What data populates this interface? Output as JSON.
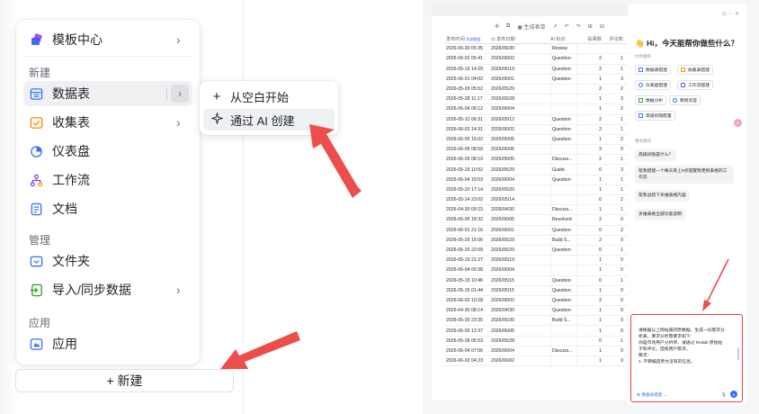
{
  "menu": {
    "header": {
      "label": "模板中心"
    },
    "section_new": "新建",
    "items_new": [
      {
        "label": "数据表",
        "icon": "table-icon",
        "color": "#3370ff"
      },
      {
        "label": "收集表",
        "icon": "form-icon",
        "color": "#ff8800"
      },
      {
        "label": "仪表盘",
        "icon": "dashboard-icon",
        "color": "#3370ff"
      },
      {
        "label": "工作流",
        "icon": "workflow-icon",
        "color": "#7f3bf5"
      },
      {
        "label": "文档",
        "icon": "doc-icon",
        "color": "#3370ff"
      }
    ],
    "section_manage": "管理",
    "items_manage": [
      {
        "label": "文件夹",
        "icon": "folder-icon",
        "color": "#3370ff"
      },
      {
        "label": "导入/同步数据",
        "icon": "import-icon",
        "color": "#2ea121"
      }
    ],
    "section_app": "应用",
    "items_app": [
      {
        "label": "应用",
        "icon": "app-icon",
        "color": "#3370ff"
      }
    ]
  },
  "new_button": {
    "label": "+ 新建"
  },
  "submenu": {
    "items": [
      {
        "label": "从空白开始",
        "icon": "plus-icon"
      },
      {
        "label": "通过 AI 创建",
        "icon": "sparkle-icon"
      }
    ]
  },
  "table": {
    "toolbar": {
      "generate_report": "生成表单"
    },
    "headers": [
      "发布时间",
      "发布日期",
      "AI 标识",
      "投票数",
      "评论数"
    ],
    "header_badge": "外部数据",
    "rows": [
      [
        "2026-06-30 05:35",
        "2026/06/30",
        "Review",
        "",
        ""
      ],
      [
        "2026-06-02 05:41",
        "2026/06/02",
        "Question",
        "2",
        "1"
      ],
      [
        "2026-05-19 14:29",
        "2026/05/19",
        "Question",
        "2",
        "1"
      ],
      [
        "2026-06-01 04:02",
        "2026/06/01",
        "Question",
        "1",
        "3"
      ],
      [
        "2026-05-29 05:52",
        "2026/05/29",
        "",
        "2",
        "2"
      ],
      [
        "2026-05-28 11:17",
        "2026/05/28",
        "",
        "1",
        "3"
      ],
      [
        "2026-06-04 06:12",
        "2026/06/04",
        "",
        "1",
        "2"
      ],
      [
        "2026-05-12 06:31",
        "2026/05/12",
        "Question",
        "2",
        "1"
      ],
      [
        "2026-06-02 14:31",
        "2026/06/02",
        "Question",
        "2",
        "1"
      ],
      [
        "2026-06-05 15:02",
        "2026/06/05",
        "Question",
        "1",
        "2"
      ],
      [
        "2026-06-06 08:59",
        "2026/06/06",
        "",
        "3",
        "0"
      ],
      [
        "2026-06-05 08:19",
        "2026/06/05",
        "Discuss...",
        "2",
        "1"
      ],
      [
        "2026-05-29 10:52",
        "2026/05/29",
        "Guide",
        "0",
        "3"
      ],
      [
        "2026-06-04 19:53",
        "2026/06/04",
        "Question",
        "1",
        "1"
      ],
      [
        "2026-05-20 17:14",
        "2026/05/20",
        "",
        "1",
        "1"
      ],
      [
        "2026-05-14 23:02",
        "2026/05/14",
        "",
        "0",
        "2"
      ],
      [
        "2026-04-30 09:23",
        "2026/04/30",
        "Discuss...",
        "1",
        "1"
      ],
      [
        "2026-06-05 18:32",
        "2026/06/05",
        "Resolved",
        "2",
        "0"
      ],
      [
        "2026-06-01 21:16",
        "2026/06/01",
        "Question",
        "0",
        "2"
      ],
      [
        "2026-05-29 15:06",
        "2026/05/29",
        "Build S...",
        "2",
        "0"
      ],
      [
        "2026-05-20 22:09",
        "2026/05/20",
        "Question",
        "0",
        "1"
      ],
      [
        "2026-05-19 21:27",
        "2026/05/19",
        "",
        "1",
        "0"
      ],
      [
        "2026-06-04 00:38",
        "2026/06/04",
        "",
        "1",
        "0"
      ],
      [
        "2026-05-15 10:46",
        "2026/05/15",
        "Question",
        "0",
        "1"
      ],
      [
        "2026-05-15 01:44",
        "2026/05/15",
        "Question",
        "1",
        "0"
      ],
      [
        "2026-06-02 10:28",
        "2026/06/02",
        "Question",
        "2",
        "0"
      ],
      [
        "2026-04-30 08:14",
        "2026/04/30",
        "Question",
        "1",
        "0"
      ],
      [
        "2026-05-30 23:35",
        "2026/05/30",
        "Build S...",
        "1",
        "0"
      ],
      [
        "2026-06-05 12:37",
        "2026/06/05",
        "",
        "1",
        "0"
      ],
      [
        "2026-05-28 05:53",
        "2026/05/28",
        "",
        "0",
        "1"
      ],
      [
        "2026-06-04 07:56",
        "2026/06/04",
        "Discuss...",
        "1",
        "0"
      ],
      [
        "2026-06-02 04:23",
        "2026/06/02",
        "",
        "1",
        "0"
      ]
    ]
  },
  "ai": {
    "greeting": "👋 Hi，今天能帮你做些什么？",
    "section_skills": "为你推荐",
    "chips": [
      {
        "label": "数据表搭建",
        "color": "#3370ff"
      },
      {
        "label": "收集表搭建",
        "color": "#ff8800"
      },
      {
        "label": "仪表盘搭建",
        "color": "#3370ff"
      },
      {
        "label": "工作流搭建",
        "color": "#7f3bf5"
      },
      {
        "label": "数据分析",
        "color": "#2ea121"
      },
      {
        "label": "教程问答",
        "color": "#3370ff"
      },
      {
        "label": "高级权限配置",
        "color": "#3370ff"
      }
    ],
    "section_questions": "猜你想问",
    "questions": [
      "高级权限是什么？",
      "帮我搭建一个每天早上9点提醒我更新表格的工作流",
      "帮我总结下多维表格内容",
      "多维表格全部功能说明"
    ],
    "input_lines": [
      "请根据以上网站表的原数据，生成一份需求分",
      "析表，要求分析需要求如下：",
      "你是市场用户分析师，请通过 Reddit 原始帖",
      "子和评论，提炼用户需求。",
      "",
      "要求：",
      "1. 不要编造原文没有的信息。"
    ],
    "footer_label": "数据表搭建"
  }
}
